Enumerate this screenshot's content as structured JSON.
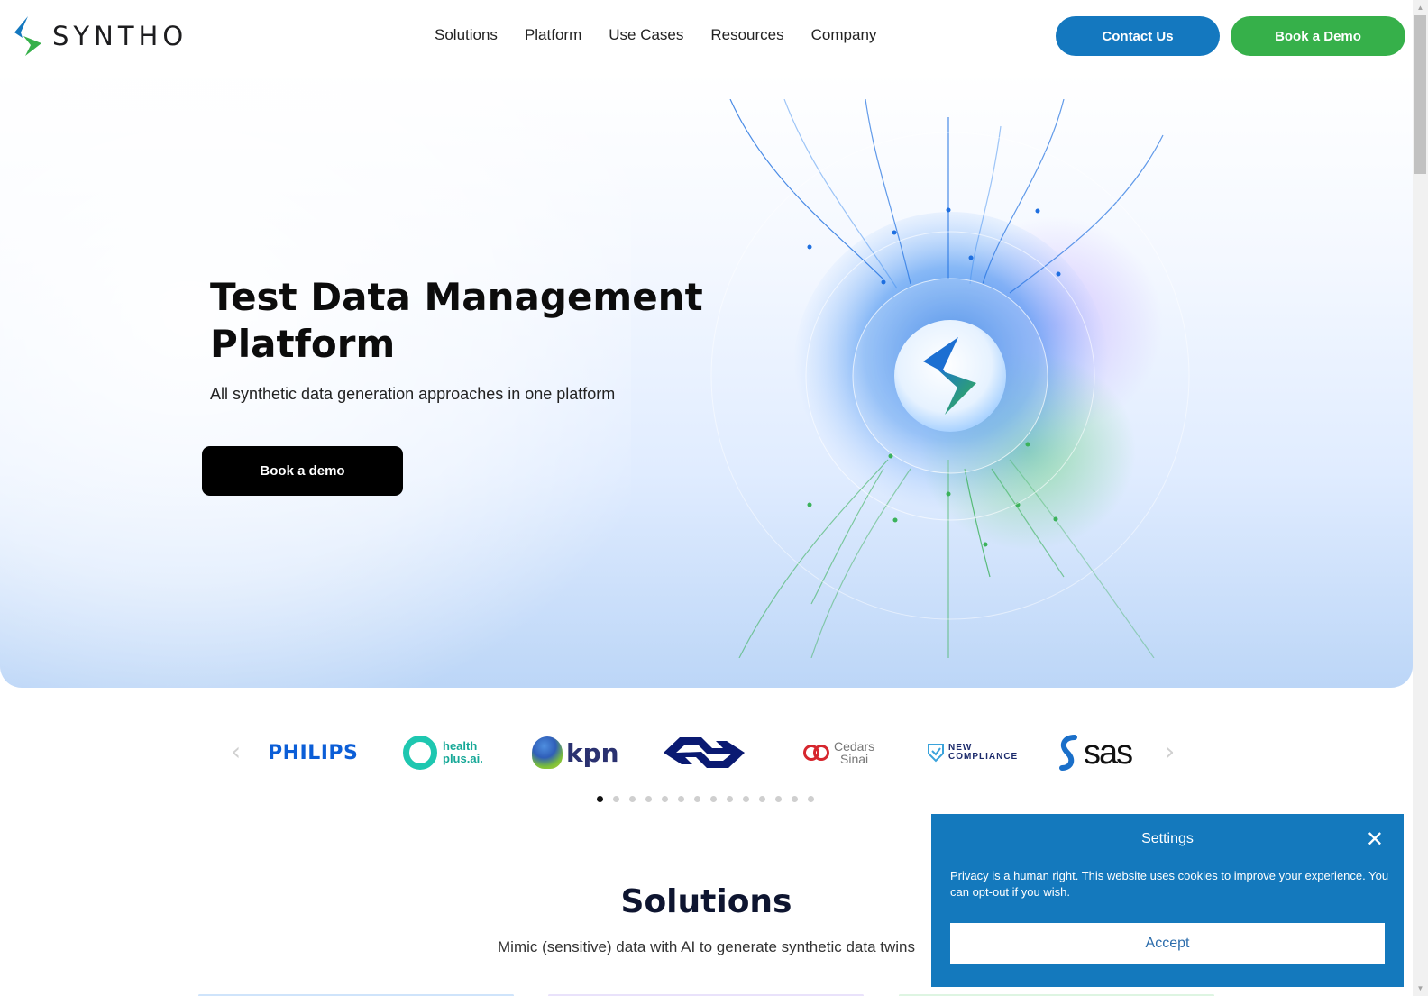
{
  "brand": {
    "name": "SYNTHO",
    "colors": {
      "blue": "#1478bf",
      "green": "#36b04a"
    }
  },
  "nav": {
    "items": [
      {
        "label": "Solutions"
      },
      {
        "label": "Platform"
      },
      {
        "label": "Use Cases"
      },
      {
        "label": "Resources"
      },
      {
        "label": "Company"
      }
    ],
    "contact_label": "Contact Us",
    "book_label": "Book a Demo"
  },
  "hero": {
    "title": "Test Data Management Platform",
    "subtitle": "All synthetic data generation approaches in one platform",
    "cta_label": "Book a demo",
    "art_icon": "syntho-orb-icon"
  },
  "clients": {
    "prev_icon": "chevron-left-icon",
    "next_icon": "chevron-right-icon",
    "logos": [
      {
        "name": "PHILIPS"
      },
      {
        "name": "health plus.ai",
        "line1": "health",
        "line2": "plus.ai."
      },
      {
        "name": "kpn"
      },
      {
        "name": "NS"
      },
      {
        "name": "Cedars Sinai",
        "line1": "Cedars",
        "line2": "Sinai"
      },
      {
        "name": "New Compliance",
        "line1": "NEW",
        "line2": "COMPLIANCE"
      },
      {
        "name": "sas"
      }
    ],
    "pagination": {
      "total": 14,
      "active": 1
    }
  },
  "solutions": {
    "title": "Solutions",
    "subtitle": "Mimic (sensitive) data with AI to generate synthetic data twins"
  },
  "cookie": {
    "title": "Settings",
    "text": "Privacy is a human right. This website uses cookies to improve your experience. You can opt-out if you wish.",
    "accept_label": "Accept",
    "close_icon": "close-icon"
  },
  "scrollbar": {
    "position": 0
  }
}
